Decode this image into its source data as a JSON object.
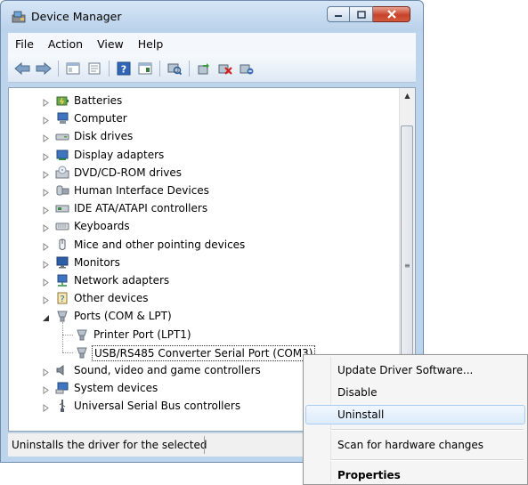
{
  "window": {
    "title": "Device Manager"
  },
  "menubar": [
    "File",
    "Action",
    "View",
    "Help"
  ],
  "toolbar": [
    "back-icon",
    "forward-icon",
    "console-tree-icon",
    "properties-icon",
    "help-icon",
    "view-icon",
    "scan-hardware-icon",
    "update-driver-icon",
    "uninstall-icon",
    "disable-icon"
  ],
  "tree": {
    "items": [
      {
        "label": "Batteries",
        "icon": "battery-icon"
      },
      {
        "label": "Computer",
        "icon": "computer-icon"
      },
      {
        "label": "Disk drives",
        "icon": "disk-drive-icon"
      },
      {
        "label": "Display adapters",
        "icon": "display-adapter-icon"
      },
      {
        "label": "DVD/CD-ROM drives",
        "icon": "dvd-drive-icon"
      },
      {
        "label": "Human Interface Devices",
        "icon": "hid-icon"
      },
      {
        "label": "IDE ATA/ATAPI controllers",
        "icon": "ide-controller-icon"
      },
      {
        "label": "Keyboards",
        "icon": "keyboard-icon"
      },
      {
        "label": "Mice and other pointing devices",
        "icon": "mouse-icon"
      },
      {
        "label": "Monitors",
        "icon": "monitor-icon"
      },
      {
        "label": "Network adapters",
        "icon": "network-adapter-icon"
      },
      {
        "label": "Other devices",
        "icon": "other-devices-icon"
      },
      {
        "label": "Ports (COM & LPT)",
        "icon": "port-icon"
      },
      {
        "label": "Printer Port (LPT1)",
        "icon": "port-icon"
      },
      {
        "label": "USB/RS485 Converter Serial Port (COM3)",
        "icon": "port-icon"
      },
      {
        "label": "Sound, video and game controllers",
        "icon": "sound-icon"
      },
      {
        "label": "System devices",
        "icon": "system-devices-icon"
      },
      {
        "label": "Universal Serial Bus controllers",
        "icon": "usb-icon"
      }
    ]
  },
  "statusbar": {
    "text": "Uninstalls the driver for the selected"
  },
  "context_menu": {
    "items": [
      {
        "label": "Update Driver Software..."
      },
      {
        "label": "Disable"
      },
      {
        "label": "Uninstall"
      },
      {
        "label": "Scan for hardware changes"
      },
      {
        "label": "Properties"
      }
    ]
  }
}
